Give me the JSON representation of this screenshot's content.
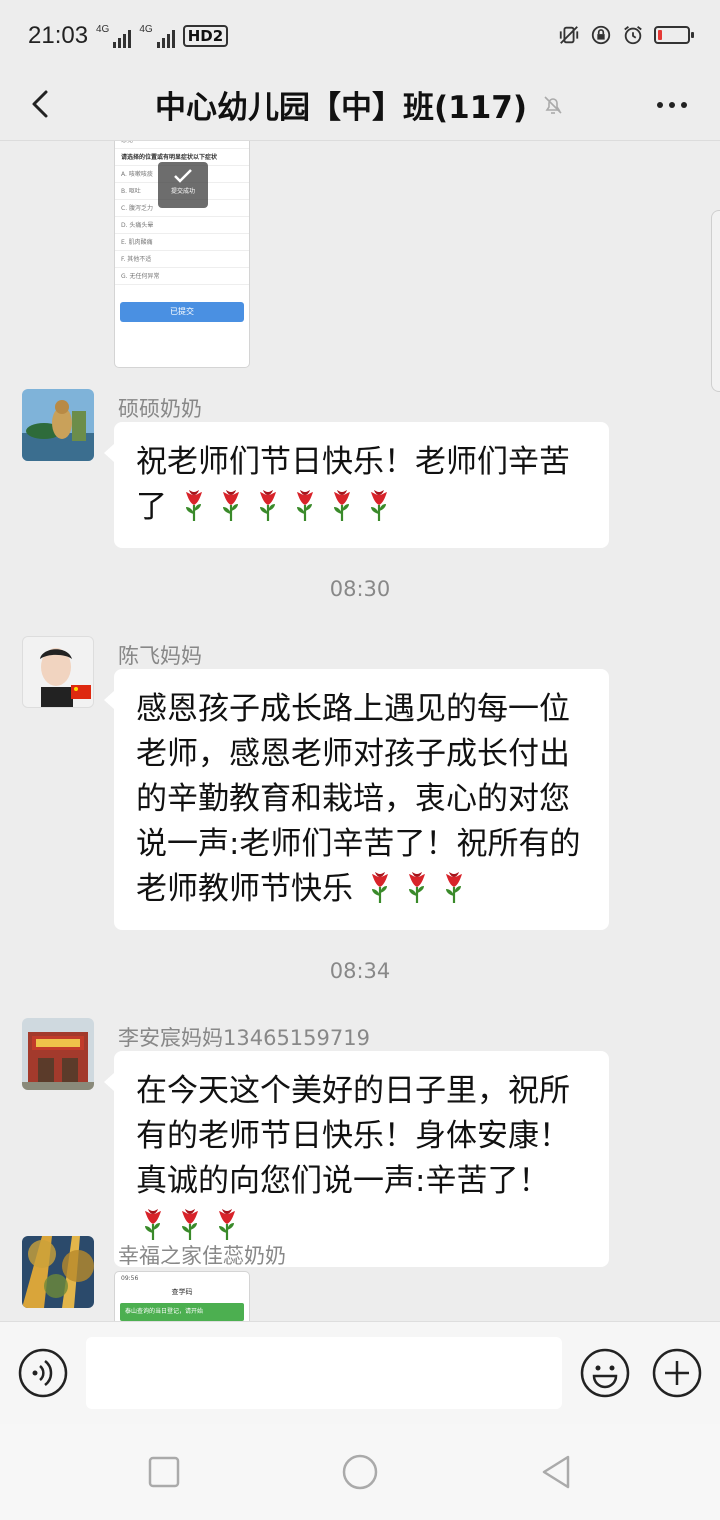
{
  "status_bar": {
    "time": "21:03",
    "network_tags": [
      "4G",
      "4G"
    ],
    "hd_label": "HD2",
    "icons": [
      "vibrate-icon",
      "lock-rotation-icon",
      "alarm-icon",
      "battery-low-icon"
    ],
    "battery_level_percent": 15,
    "battery_color": "#e53935"
  },
  "header": {
    "title": "中心幼儿园【中】班(117)",
    "back_icon": "chevron-left-icon",
    "mute_icon": "bell-off-icon",
    "more_icon": "more-horizontal-icon"
  },
  "messages": [
    {
      "type": "image",
      "thumbnail": {
        "top_line": "意见",
        "question": "请选择的位置或有明显症状以下症状",
        "options": [
          "A. 咳嗽咳痰",
          "B. 呕吐",
          "C. 腹泻乏力",
          "D. 头痛头晕",
          "E. 肌肉酸痛",
          "F. 其他不适",
          "G. 无任何异常"
        ],
        "toast": "提交成功",
        "button": "已提交"
      }
    },
    {
      "type": "text",
      "sender": "硕硕奶奶",
      "text": "祝老师们节日快乐！老师们辛苦了",
      "emoji": [
        "rose",
        "rose",
        "rose",
        "rose",
        "rose",
        "rose"
      ]
    },
    {
      "type": "time",
      "text": "08:30"
    },
    {
      "type": "text",
      "sender": "陈飞妈妈",
      "text": "感恩孩子成长路上遇见的每一位老师，感恩老师对孩子成长付出的辛勤教育和栽培，衷心的对您说一声:老师们辛苦了！祝所有的老师教师节快乐",
      "emoji": [
        "rose",
        "rose",
        "rose"
      ]
    },
    {
      "type": "time",
      "text": "08:34"
    },
    {
      "type": "text",
      "sender": "李安宸妈妈13465159719",
      "text": "在今天这个美好的日子里，祝所有的老师节日快乐！身体安康！真诚的向您们说一声:辛苦了！",
      "emoji": [
        "rose",
        "rose",
        "rose"
      ]
    },
    {
      "type": "image",
      "sender": "幸福之家佳蕊奶奶",
      "thumbnail": {
        "status_time": "09:56",
        "title": "查学码",
        "bar_text": "泰山查询的当日登记，请开始"
      }
    }
  ],
  "input_bar": {
    "placeholder": "",
    "voice_icon": "voice-input-icon",
    "emoji_icon": "emoji-smile-icon",
    "plus_icon": "plus-circle-icon"
  },
  "nav_bar": {
    "icons": [
      "recents-square-icon",
      "home-circle-icon",
      "back-triangle-icon"
    ]
  },
  "colors": {
    "background": "#ededed",
    "bubble": "#ffffff",
    "secondary_text": "#888888",
    "accent_blue": "#4a90e2"
  }
}
